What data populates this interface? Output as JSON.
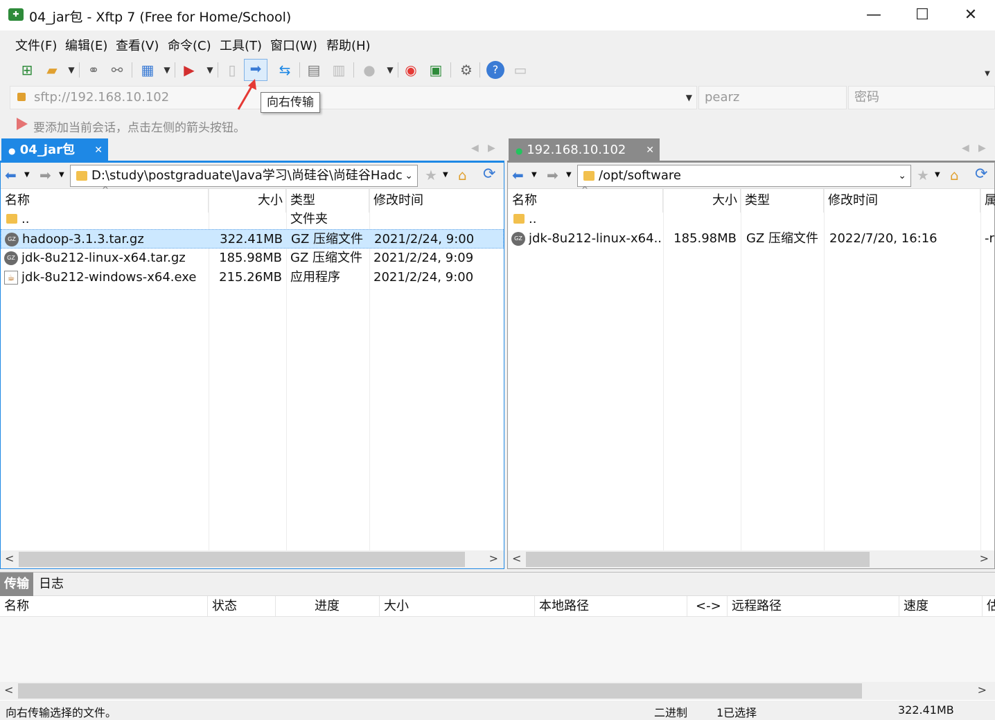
{
  "window": {
    "title": "04_jar包 - Xftp 7 (Free for Home/School)",
    "minimize": "—",
    "maximize": "☐",
    "close": "✕"
  },
  "menu": [
    "文件(F)",
    "编辑(E)",
    "查看(V)",
    "命令(C)",
    "工具(T)",
    "窗口(W)",
    "帮助(H)"
  ],
  "address": {
    "url": "sftp://192.168.10.102",
    "user": "pearz",
    "password": "密码"
  },
  "tooltip": "向右传输",
  "hint": "要添加当前会话，点击左侧的箭头按钮。",
  "colors": {
    "accent": "#1e88e5",
    "inactive_tab": "#8a8a8a",
    "selected_row": "#cce8ff",
    "arrow": "#e53935",
    "connected": "#22c55e"
  },
  "left": {
    "tab": "04_jar包",
    "path": "D:\\study\\postgraduate\\Java学习\\尚硅谷\\尚硅谷Hadc",
    "columns": [
      "名称",
      "大小",
      "类型",
      "修改时间"
    ],
    "rows": [
      {
        "name": "..",
        "size": "",
        "type": "文件夹",
        "modified": ""
      },
      {
        "name": "hadoop-3.1.3.tar.gz",
        "size": "322.41MB",
        "type": "GZ 压缩文件",
        "modified": "2021/2/24, 9:00"
      },
      {
        "name": "jdk-8u212-linux-x64.tar.gz",
        "size": "185.98MB",
        "type": "GZ 压缩文件",
        "modified": "2021/2/24, 9:09"
      },
      {
        "name": "jdk-8u212-windows-x64.exe",
        "size": "215.26MB",
        "type": "应用程序",
        "modified": "2021/2/24, 9:00"
      }
    ]
  },
  "right": {
    "tab": "192.168.10.102",
    "path": "/opt/software",
    "columns": [
      "名称",
      "大小",
      "类型",
      "修改时间",
      "属"
    ],
    "rows": [
      {
        "name": "..",
        "size": "",
        "type": "",
        "modified": "",
        "attr": ""
      },
      {
        "name": "jdk-8u212-linux-x64...",
        "size": "185.98MB",
        "type": "GZ 压缩文件",
        "modified": "2022/7/20, 16:16",
        "attr": "-r"
      }
    ]
  },
  "transfer": {
    "tabs": [
      "传输",
      "日志"
    ],
    "columns": [
      "名称",
      "状态",
      "进度",
      "大小",
      "本地路径",
      "<->",
      "远程路径",
      "速度",
      "估"
    ]
  },
  "status": {
    "message": "向右传输选择的文件。",
    "mode": "二进制",
    "selected": "1已选择",
    "size": "322.41MB"
  }
}
